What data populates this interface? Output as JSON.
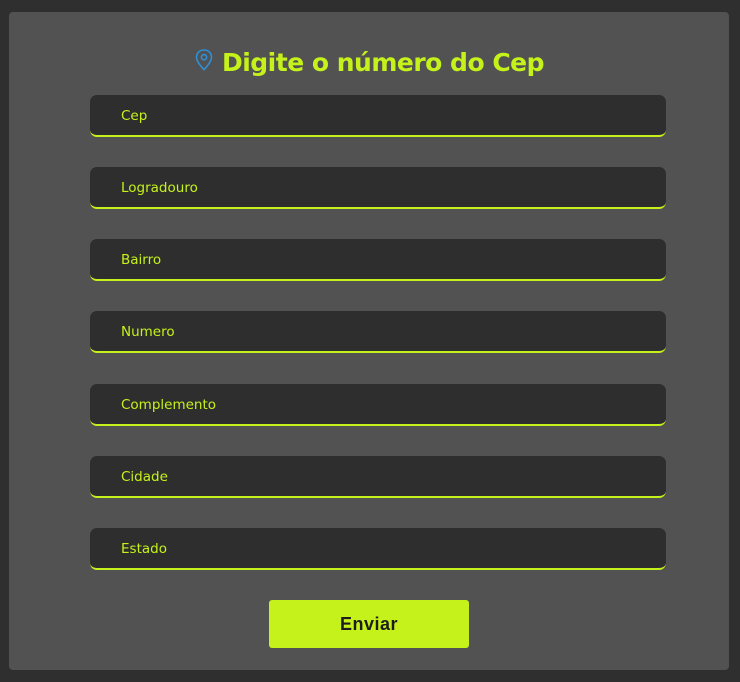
{
  "header": {
    "title": "Digite o número do Cep",
    "icon": "map-pin-icon",
    "icon_color": "#2f8fd6"
  },
  "form": {
    "fields": [
      {
        "label": "Cep"
      },
      {
        "label": "Logradouro"
      },
      {
        "label": "Bairro"
      },
      {
        "label": "Numero"
      },
      {
        "label": "Complemento"
      },
      {
        "label": "Cidade"
      },
      {
        "label": "Estado"
      }
    ],
    "submit_label": "Enviar"
  },
  "colors": {
    "accent": "#c5f21a",
    "background": "#2f2f2f",
    "card": "#525252",
    "field": "#2e2e2e"
  }
}
